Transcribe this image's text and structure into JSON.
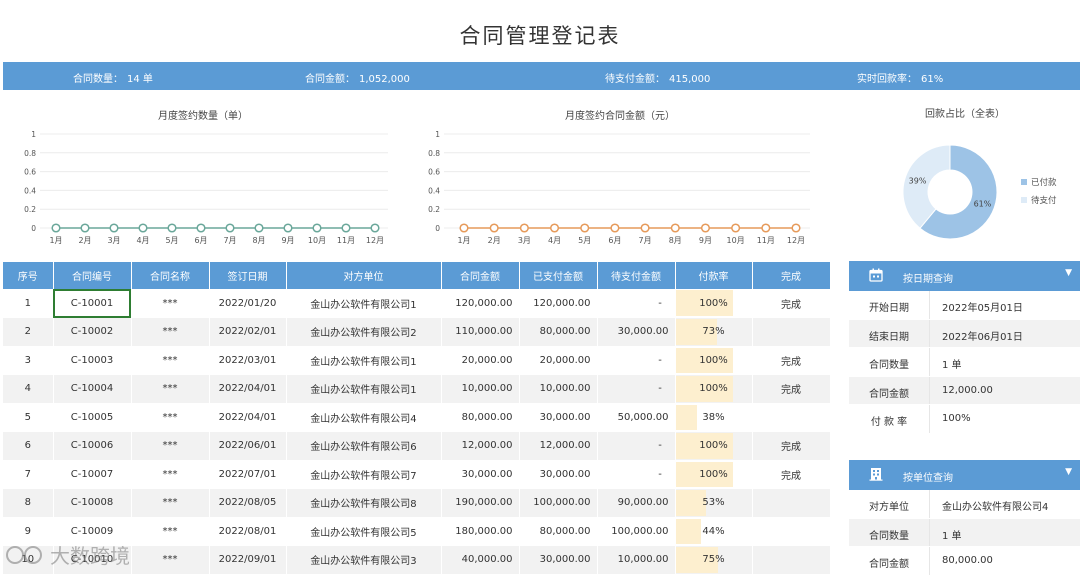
{
  "title": "合同管理登记表",
  "summary": {
    "count_label": "合同数量：",
    "count_value": "14 单",
    "amount_label": "合同金额：",
    "amount_value": "1,052,000",
    "pending_label": "待支付金额：",
    "pending_value": "415,000",
    "rate_label": "实时回款率：",
    "rate_value": "61%"
  },
  "charts": {
    "count_title": "月度签约数量（单）",
    "amount_title": "月度签约合同金额（元）",
    "pie_title": "回款占比（全表）"
  },
  "chart_data": [
    {
      "type": "line",
      "title": "月度签约数量（单）",
      "categories": [
        "1月",
        "2月",
        "3月",
        "4月",
        "5月",
        "6月",
        "7月",
        "8月",
        "9月",
        "10月",
        "11月",
        "12月"
      ],
      "yticks": [
        "1",
        "0.8",
        "0.6",
        "0.4",
        "0.2",
        "0"
      ],
      "values": [
        0,
        0,
        0,
        0,
        0,
        0,
        0,
        0,
        0,
        0,
        0,
        0
      ],
      "ylim": [
        0,
        1
      ],
      "color": "#6aa79a"
    },
    {
      "type": "line",
      "title": "月度签约合同金额（元）",
      "categories": [
        "1月",
        "2月",
        "3月",
        "4月",
        "5月",
        "6月",
        "7月",
        "8月",
        "9月",
        "10月",
        "11月",
        "12月"
      ],
      "yticks": [
        "1",
        "0.8",
        "0.6",
        "0.4",
        "0.2",
        "0"
      ],
      "values": [
        0,
        0,
        0,
        0,
        0,
        0,
        0,
        0,
        0,
        0,
        0,
        0
      ],
      "ylim": [
        0,
        1
      ],
      "color": "#e69a5a"
    },
    {
      "type": "pie",
      "title": "回款占比（全表）",
      "slices": [
        {
          "name": "已付款",
          "value": 61,
          "label": "61%",
          "color": "#9dc3e6"
        },
        {
          "name": "待支付",
          "value": 39,
          "label": "39%",
          "color": "#deebf7"
        }
      ]
    }
  ],
  "table": {
    "headers": [
      "序号",
      "合同编号",
      "合同名称",
      "签订日期",
      "对方单位",
      "合同金额",
      "已支付金额",
      "待支付金额",
      "付款率",
      "完成"
    ],
    "rows": [
      {
        "no": "1",
        "code": "C-10001",
        "name": "***",
        "date": "2022/01/20",
        "party": "金山办公软件有限公司1",
        "amount": "120,000.00",
        "paid": "120,000.00",
        "pending": "-",
        "rate": "100%",
        "rate_value": 100,
        "done": "完成"
      },
      {
        "no": "2",
        "code": "C-10002",
        "name": "***",
        "date": "2022/02/01",
        "party": "金山办公软件有限公司2",
        "amount": "110,000.00",
        "paid": "80,000.00",
        "pending": "30,000.00",
        "rate": "73%",
        "rate_value": 73,
        "done": ""
      },
      {
        "no": "3",
        "code": "C-10003",
        "name": "***",
        "date": "2022/03/01",
        "party": "金山办公软件有限公司1",
        "amount": "20,000.00",
        "paid": "20,000.00",
        "pending": "-",
        "rate": "100%",
        "rate_value": 100,
        "done": "完成"
      },
      {
        "no": "4",
        "code": "C-10004",
        "name": "***",
        "date": "2022/04/01",
        "party": "金山办公软件有限公司1",
        "amount": "10,000.00",
        "paid": "10,000.00",
        "pending": "-",
        "rate": "100%",
        "rate_value": 100,
        "done": "完成"
      },
      {
        "no": "5",
        "code": "C-10005",
        "name": "***",
        "date": "2022/04/01",
        "party": "金山办公软件有限公司4",
        "amount": "80,000.00",
        "paid": "30,000.00",
        "pending": "50,000.00",
        "rate": "38%",
        "rate_value": 38,
        "done": ""
      },
      {
        "no": "6",
        "code": "C-10006",
        "name": "***",
        "date": "2022/06/01",
        "party": "金山办公软件有限公司6",
        "amount": "12,000.00",
        "paid": "12,000.00",
        "pending": "-",
        "rate": "100%",
        "rate_value": 100,
        "done": "完成"
      },
      {
        "no": "7",
        "code": "C-10007",
        "name": "***",
        "date": "2022/07/01",
        "party": "金山办公软件有限公司7",
        "amount": "30,000.00",
        "paid": "30,000.00",
        "pending": "-",
        "rate": "100%",
        "rate_value": 100,
        "done": "完成"
      },
      {
        "no": "8",
        "code": "C-10008",
        "name": "***",
        "date": "2022/08/05",
        "party": "金山办公软件有限公司8",
        "amount": "190,000.00",
        "paid": "100,000.00",
        "pending": "90,000.00",
        "rate": "53%",
        "rate_value": 53,
        "done": ""
      },
      {
        "no": "9",
        "code": "C-10009",
        "name": "***",
        "date": "2022/08/01",
        "party": "金山办公软件有限公司5",
        "amount": "180,000.00",
        "paid": "80,000.00",
        "pending": "100,000.00",
        "rate": "44%",
        "rate_value": 44,
        "done": ""
      },
      {
        "no": "10",
        "code": "C-10010",
        "name": "***",
        "date": "2022/09/01",
        "party": "金山办公软件有限公司3",
        "amount": "40,000.00",
        "paid": "30,000.00",
        "pending": "10,000.00",
        "rate": "75%",
        "rate_value": 75,
        "done": ""
      }
    ]
  },
  "date_query": {
    "title": "按日期查询",
    "icon": "calendar-icon",
    "rows": [
      {
        "label": "开始日期",
        "value": "2022年05月01日"
      },
      {
        "label": "结束日期",
        "value": "2022年06月01日"
      },
      {
        "label": "合同数量",
        "value": "1 单"
      },
      {
        "label": "合同金额",
        "value": "12,000.00"
      },
      {
        "label": "付 款 率",
        "value": "100%"
      }
    ]
  },
  "unit_query": {
    "title": "按单位查询",
    "icon": "building-icon",
    "rows": [
      {
        "label": "对方单位",
        "value": "金山办公软件有限公司4"
      },
      {
        "label": "合同数量",
        "value": "1 单"
      },
      {
        "label": "合同金额",
        "value": "80,000.00"
      }
    ]
  },
  "watermark": "大数跨境",
  "colors": {
    "header_blue": "#5b9bd5",
    "rate_bar": "#fdefcf",
    "selected_border": "#2e7d32"
  }
}
